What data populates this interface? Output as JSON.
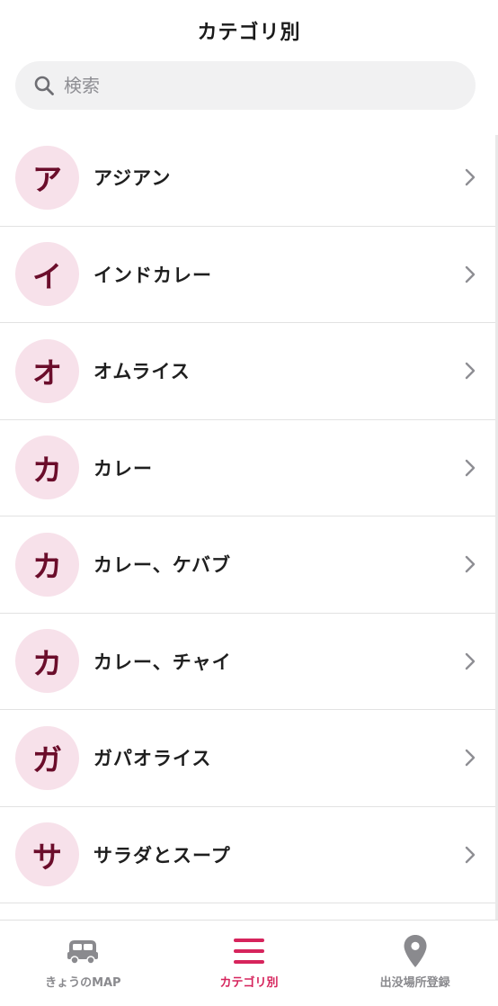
{
  "header": {
    "title": "カテゴリ別"
  },
  "search": {
    "placeholder": "検索",
    "value": ""
  },
  "categories": [
    {
      "initial": "ア",
      "label": "アジアン"
    },
    {
      "initial": "イ",
      "label": "インドカレー"
    },
    {
      "initial": "オ",
      "label": "オムライス"
    },
    {
      "initial": "カ",
      "label": "カレー"
    },
    {
      "initial": "カ",
      "label": "カレー、ケバブ"
    },
    {
      "initial": "カ",
      "label": "カレー、チャイ"
    },
    {
      "initial": "ガ",
      "label": "ガパオライス"
    },
    {
      "initial": "サ",
      "label": "サラダとスープ"
    }
  ],
  "tabbar": {
    "tabs": [
      {
        "label": "きょうのMAP",
        "icon": "car-icon",
        "active": false
      },
      {
        "label": "カテゴリ別",
        "icon": "menu-icon",
        "active": true
      },
      {
        "label": "出没場所登録",
        "icon": "map-pin-icon",
        "active": false
      }
    ]
  },
  "colors": {
    "accent": "#d6245c",
    "avatar_bg": "#f7e1ea",
    "avatar_text": "#6b0d2b",
    "inactive_tab": "#8a8a8e"
  }
}
